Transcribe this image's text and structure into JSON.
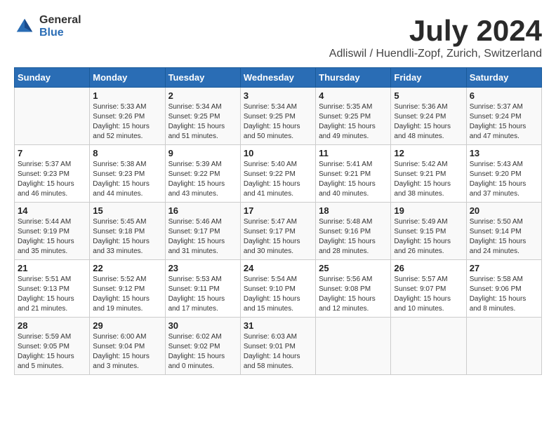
{
  "logo": {
    "general": "General",
    "blue": "Blue"
  },
  "title": "July 2024",
  "subtitle": "Adliswil / Huendli-Zopf, Zurich, Switzerland",
  "days_header": [
    "Sunday",
    "Monday",
    "Tuesday",
    "Wednesday",
    "Thursday",
    "Friday",
    "Saturday"
  ],
  "weeks": [
    [
      {
        "num": "",
        "info": ""
      },
      {
        "num": "1",
        "info": "Sunrise: 5:33 AM\nSunset: 9:26 PM\nDaylight: 15 hours\nand 52 minutes."
      },
      {
        "num": "2",
        "info": "Sunrise: 5:34 AM\nSunset: 9:25 PM\nDaylight: 15 hours\nand 51 minutes."
      },
      {
        "num": "3",
        "info": "Sunrise: 5:34 AM\nSunset: 9:25 PM\nDaylight: 15 hours\nand 50 minutes."
      },
      {
        "num": "4",
        "info": "Sunrise: 5:35 AM\nSunset: 9:25 PM\nDaylight: 15 hours\nand 49 minutes."
      },
      {
        "num": "5",
        "info": "Sunrise: 5:36 AM\nSunset: 9:24 PM\nDaylight: 15 hours\nand 48 minutes."
      },
      {
        "num": "6",
        "info": "Sunrise: 5:37 AM\nSunset: 9:24 PM\nDaylight: 15 hours\nand 47 minutes."
      }
    ],
    [
      {
        "num": "7",
        "info": "Sunrise: 5:37 AM\nSunset: 9:23 PM\nDaylight: 15 hours\nand 46 minutes."
      },
      {
        "num": "8",
        "info": "Sunrise: 5:38 AM\nSunset: 9:23 PM\nDaylight: 15 hours\nand 44 minutes."
      },
      {
        "num": "9",
        "info": "Sunrise: 5:39 AM\nSunset: 9:22 PM\nDaylight: 15 hours\nand 43 minutes."
      },
      {
        "num": "10",
        "info": "Sunrise: 5:40 AM\nSunset: 9:22 PM\nDaylight: 15 hours\nand 41 minutes."
      },
      {
        "num": "11",
        "info": "Sunrise: 5:41 AM\nSunset: 9:21 PM\nDaylight: 15 hours\nand 40 minutes."
      },
      {
        "num": "12",
        "info": "Sunrise: 5:42 AM\nSunset: 9:21 PM\nDaylight: 15 hours\nand 38 minutes."
      },
      {
        "num": "13",
        "info": "Sunrise: 5:43 AM\nSunset: 9:20 PM\nDaylight: 15 hours\nand 37 minutes."
      }
    ],
    [
      {
        "num": "14",
        "info": "Sunrise: 5:44 AM\nSunset: 9:19 PM\nDaylight: 15 hours\nand 35 minutes."
      },
      {
        "num": "15",
        "info": "Sunrise: 5:45 AM\nSunset: 9:18 PM\nDaylight: 15 hours\nand 33 minutes."
      },
      {
        "num": "16",
        "info": "Sunrise: 5:46 AM\nSunset: 9:17 PM\nDaylight: 15 hours\nand 31 minutes."
      },
      {
        "num": "17",
        "info": "Sunrise: 5:47 AM\nSunset: 9:17 PM\nDaylight: 15 hours\nand 30 minutes."
      },
      {
        "num": "18",
        "info": "Sunrise: 5:48 AM\nSunset: 9:16 PM\nDaylight: 15 hours\nand 28 minutes."
      },
      {
        "num": "19",
        "info": "Sunrise: 5:49 AM\nSunset: 9:15 PM\nDaylight: 15 hours\nand 26 minutes."
      },
      {
        "num": "20",
        "info": "Sunrise: 5:50 AM\nSunset: 9:14 PM\nDaylight: 15 hours\nand 24 minutes."
      }
    ],
    [
      {
        "num": "21",
        "info": "Sunrise: 5:51 AM\nSunset: 9:13 PM\nDaylight: 15 hours\nand 21 minutes."
      },
      {
        "num": "22",
        "info": "Sunrise: 5:52 AM\nSunset: 9:12 PM\nDaylight: 15 hours\nand 19 minutes."
      },
      {
        "num": "23",
        "info": "Sunrise: 5:53 AM\nSunset: 9:11 PM\nDaylight: 15 hours\nand 17 minutes."
      },
      {
        "num": "24",
        "info": "Sunrise: 5:54 AM\nSunset: 9:10 PM\nDaylight: 15 hours\nand 15 minutes."
      },
      {
        "num": "25",
        "info": "Sunrise: 5:56 AM\nSunset: 9:08 PM\nDaylight: 15 hours\nand 12 minutes."
      },
      {
        "num": "26",
        "info": "Sunrise: 5:57 AM\nSunset: 9:07 PM\nDaylight: 15 hours\nand 10 minutes."
      },
      {
        "num": "27",
        "info": "Sunrise: 5:58 AM\nSunset: 9:06 PM\nDaylight: 15 hours\nand 8 minutes."
      }
    ],
    [
      {
        "num": "28",
        "info": "Sunrise: 5:59 AM\nSunset: 9:05 PM\nDaylight: 15 hours\nand 5 minutes."
      },
      {
        "num": "29",
        "info": "Sunrise: 6:00 AM\nSunset: 9:04 PM\nDaylight: 15 hours\nand 3 minutes."
      },
      {
        "num": "30",
        "info": "Sunrise: 6:02 AM\nSunset: 9:02 PM\nDaylight: 15 hours\nand 0 minutes."
      },
      {
        "num": "31",
        "info": "Sunrise: 6:03 AM\nSunset: 9:01 PM\nDaylight: 14 hours\nand 58 minutes."
      },
      {
        "num": "",
        "info": ""
      },
      {
        "num": "",
        "info": ""
      },
      {
        "num": "",
        "info": ""
      }
    ]
  ]
}
